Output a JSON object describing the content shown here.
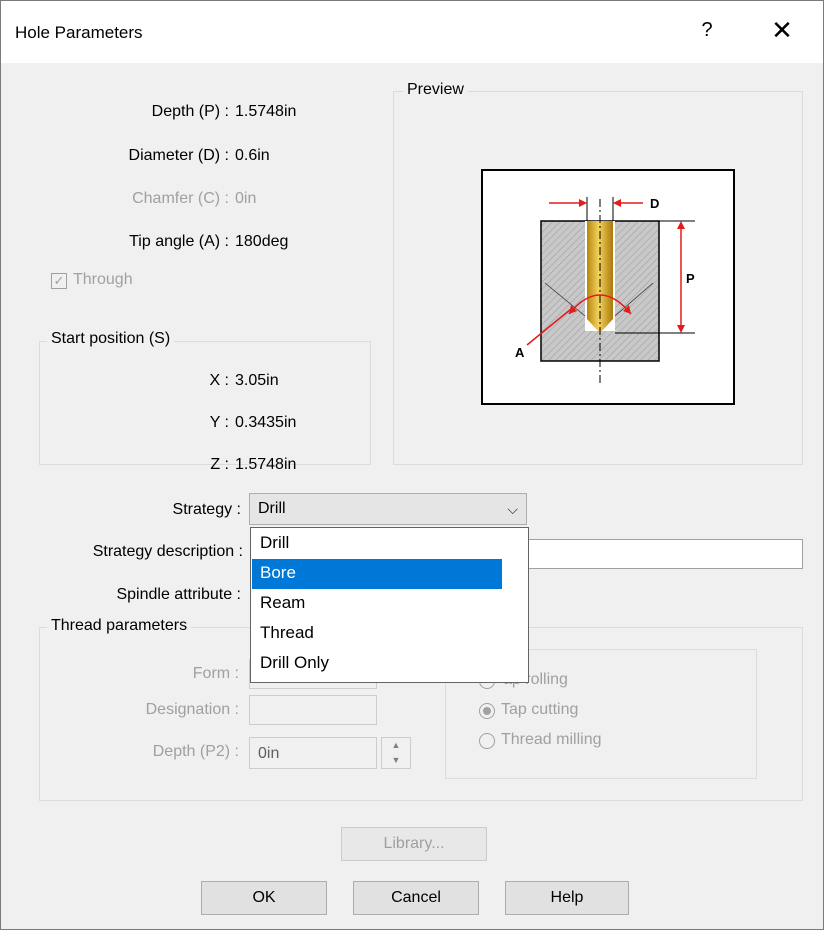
{
  "window": {
    "title": "Hole Parameters",
    "help_glyph": "?",
    "close_glyph": "✕"
  },
  "params": {
    "depth_label": "Depth (P) :",
    "depth_value": "1.5748in",
    "diameter_label": "Diameter (D) :",
    "diameter_value": "0.6in",
    "chamfer_label": "Chamfer (C) :",
    "chamfer_value": "0in",
    "tip_label": "Tip angle (A) :",
    "tip_value": "180deg",
    "through_label": "Through",
    "through_checked": true
  },
  "start_position": {
    "title": "Start position (S)",
    "x_label": "X :",
    "x_value": "3.05in",
    "y_label": "Y :",
    "y_value": "0.3435in",
    "z_label": "Z :",
    "z_value": "1.5748in"
  },
  "preview": {
    "title": "Preview",
    "labels": {
      "d": "D",
      "p": "P",
      "a": "A"
    }
  },
  "strategy": {
    "label": "Strategy :",
    "value": "Drill",
    "description_label": "Strategy description :",
    "spindle_label": "Spindle attribute :",
    "options": [
      "Drill",
      "Bore",
      "Ream",
      "Thread",
      "Drill Only"
    ],
    "highlighted": "Bore"
  },
  "thread": {
    "title": "Thread parameters",
    "form_label": "Form :",
    "designation_label": "Designation :",
    "depth_label": "Depth (P2) :",
    "depth_value": "0in",
    "radio_options": [
      "Tap rolling",
      "Tap cutting",
      "Thread milling"
    ],
    "radio_visible_text": [
      "ap rolling",
      "Tap cutting",
      "Thread milling"
    ],
    "selected_radio": "Tap cutting"
  },
  "buttons": {
    "library": "Library...",
    "ok": "OK",
    "cancel": "Cancel",
    "help": "Help"
  },
  "icons": {
    "checkbox": "check-icon",
    "combo": "chevron-down-icon",
    "spin_up": "spin-up-icon",
    "spin_down": "spin-down-icon"
  },
  "colors": {
    "accent": "#0078d7",
    "dim_red": "#e31b1b",
    "drill_gold": "#d4a017"
  }
}
